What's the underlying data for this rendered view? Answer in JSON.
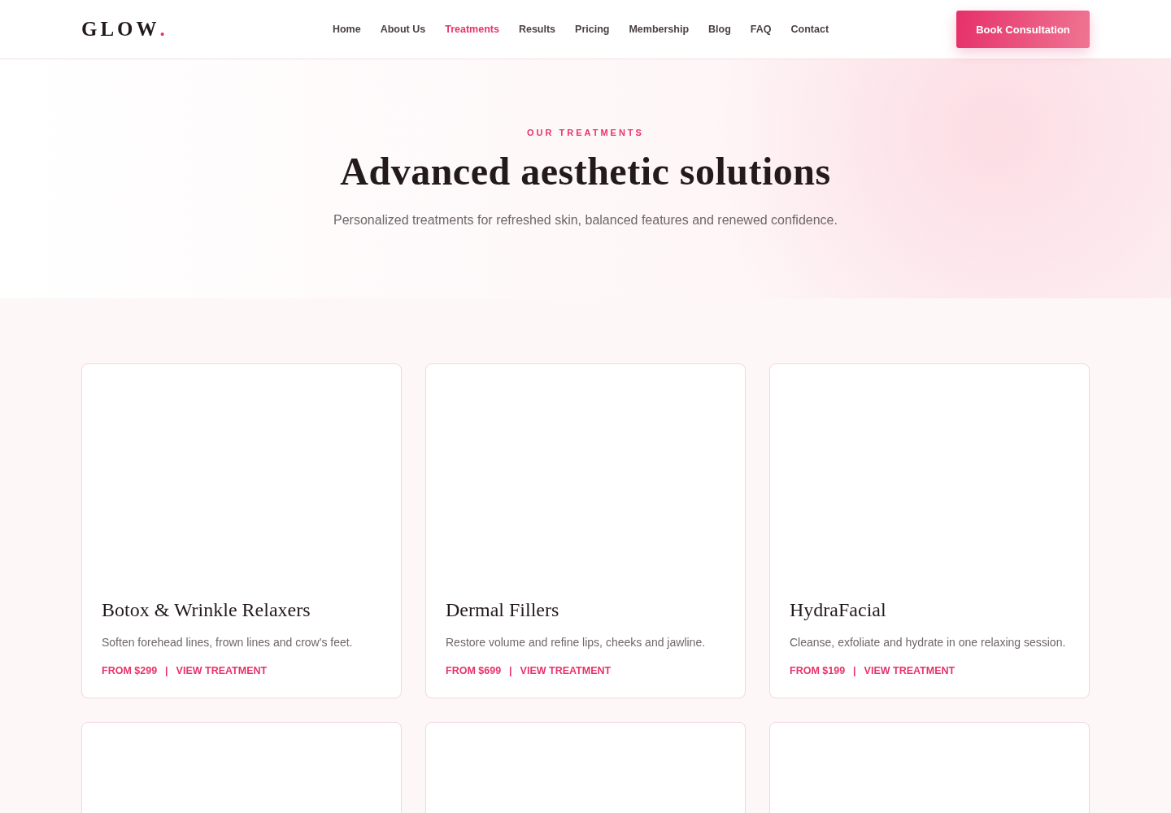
{
  "header": {
    "logo": {
      "text": "GLOW",
      "mark": "."
    },
    "nav": [
      {
        "label": "Home",
        "selected": false
      },
      {
        "label": "About Us",
        "selected": false
      },
      {
        "label": "Treatments",
        "selected": true
      },
      {
        "label": "Results",
        "selected": false
      },
      {
        "label": "Pricing",
        "selected": false
      },
      {
        "label": "Membership",
        "selected": false
      },
      {
        "label": "Blog",
        "selected": false
      },
      {
        "label": "FAQ",
        "selected": false
      },
      {
        "label": "Contact",
        "selected": false
      }
    ],
    "cta": "Book Consultation"
  },
  "hero": {
    "eyebrow": "OUR TREATMENTS",
    "title": "Advanced aesthetic solutions",
    "subtitle": "Personalized treatments for refreshed skin, balanced features and renewed confidence."
  },
  "cards": [
    {
      "kind": "treatment",
      "title": "Botox & Wrinkle Relaxers",
      "description": "Soften forehead lines, frown lines and crow's feet.",
      "price": "FROM $299",
      "separator": "|",
      "link": "VIEW TREATMENT"
    },
    {
      "kind": "treatment",
      "title": "Dermal Fillers",
      "description": "Restore volume and refine lips, cheeks and jawline.",
      "price": "FROM $699",
      "separator": "|",
      "link": "VIEW TREATMENT"
    },
    {
      "kind": "treatment",
      "title": "HydraFacial",
      "description": "Cleanse, exfoliate and hydrate in one relaxing session.",
      "price": "FROM $199",
      "separator": "|",
      "link": "VIEW TREATMENT"
    },
    {
      "kind": "blank"
    },
    {
      "kind": "blank"
    },
    {
      "kind": "blank"
    }
  ]
}
